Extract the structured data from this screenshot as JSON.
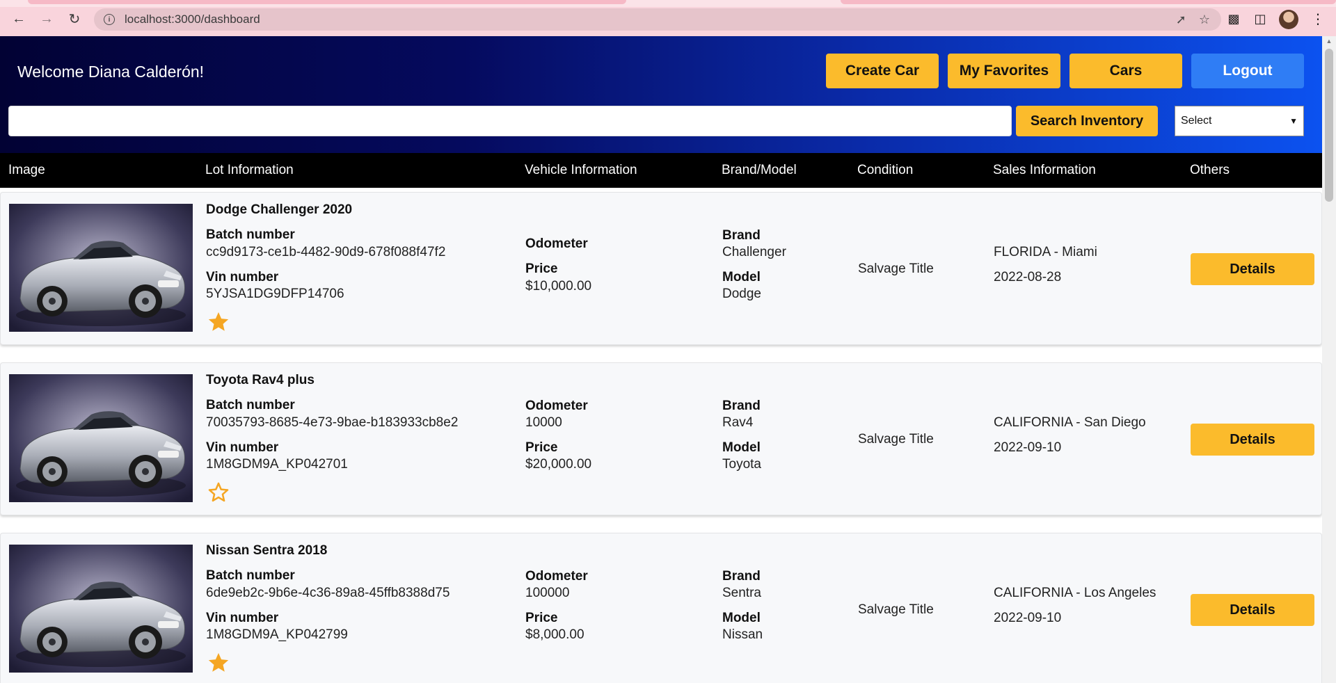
{
  "browser": {
    "url": "localhost:3000/dashboard"
  },
  "header": {
    "welcome": "Welcome Diana Calderón!",
    "buttons": {
      "create_car": "Create Car",
      "my_favorites": "My Favorites",
      "cars": "Cars",
      "logout": "Logout"
    },
    "search": {
      "value": "",
      "button": "Search Inventory"
    },
    "filter_select": {
      "selected": "Select"
    }
  },
  "table": {
    "columns": [
      "Image",
      "Lot Information",
      "Vehicle Information",
      "Brand/Model",
      "Condition",
      "Sales Information",
      "Others"
    ],
    "rows": [
      {
        "title": "Dodge Challenger 2020",
        "batch_label": "Batch number",
        "batch": "cc9d9173-ce1b-4482-90d9-678f088f47f2",
        "vin_label": "Vin number",
        "vin": "5YJSA1DG9DFP14706",
        "favorite": true,
        "odometer_label": "Odometer",
        "odometer": "",
        "price_label": "Price",
        "price": "$10,000.00",
        "brand_label": "Brand",
        "brand": "Challenger",
        "model_label": "Model",
        "model": "Dodge",
        "condition": "Salvage Title",
        "location": "FLORIDA - Miami",
        "date": "2022-08-28",
        "details": "Details"
      },
      {
        "title": "Toyota Rav4 plus",
        "batch_label": "Batch number",
        "batch": "70035793-8685-4e73-9bae-b183933cb8e2",
        "vin_label": "Vin number",
        "vin": "1M8GDM9A_KP042701",
        "favorite": false,
        "odometer_label": "Odometer",
        "odometer": "10000",
        "price_label": "Price",
        "price": "$20,000.00",
        "brand_label": "Brand",
        "brand": "Rav4",
        "model_label": "Model",
        "model": "Toyota",
        "condition": "Salvage Title",
        "location": "CALIFORNIA - San Diego",
        "date": "2022-09-10",
        "details": "Details"
      },
      {
        "title": "Nissan Sentra 2018",
        "batch_label": "Batch number",
        "batch": "6de9eb2c-9b6e-4c36-89a8-45ffb8388d75",
        "vin_label": "Vin number",
        "vin": "1M8GDM9A_KP042799",
        "favorite": true,
        "odometer_label": "Odometer",
        "odometer": "100000",
        "price_label": "Price",
        "price": "$8,000.00",
        "brand_label": "Brand",
        "brand": "Sentra",
        "model_label": "Model",
        "model": "Nissan",
        "condition": "Salvage Title",
        "location": "CALIFORNIA - Los Angeles",
        "date": "2022-09-10",
        "details": "Details"
      }
    ]
  },
  "colors": {
    "accent_yellow": "#fbbb2c",
    "logout_blue": "#2f7df5",
    "header_dark": "#020234",
    "header_light": "#0c52f0",
    "star": "#f5a623"
  }
}
